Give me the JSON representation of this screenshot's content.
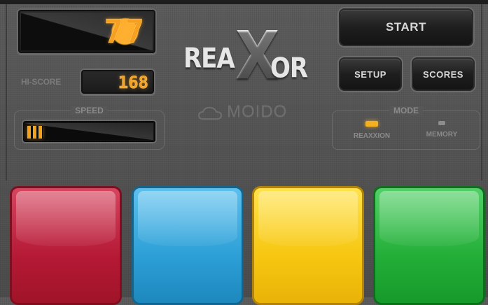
{
  "score": {
    "value": "77"
  },
  "hiscore": {
    "label": "HI-SCORE",
    "value": "168"
  },
  "speed": {
    "label": "SPEED",
    "level": 0.12
  },
  "logo": {
    "part1": "REA",
    "x": "X",
    "part2": "OR"
  },
  "watermark": {
    "text": "MOIDO"
  },
  "buttons": {
    "start": "START",
    "setup": "SETUP",
    "scores": "SCORES"
  },
  "mode": {
    "label": "MODE",
    "options": [
      {
        "label": "REAXXION",
        "selected": true
      },
      {
        "label": "MEMORY",
        "selected": false
      }
    ]
  },
  "pads": [
    {
      "color": "#b51935",
      "name": "red"
    },
    {
      "color": "#2c9fd6",
      "name": "blue"
    },
    {
      "color": "#f6c611",
      "name": "yellow"
    },
    {
      "color": "#23ae38",
      "name": "green"
    }
  ],
  "colors": {
    "lcd_text": "#f5a020",
    "background": "#555555"
  }
}
